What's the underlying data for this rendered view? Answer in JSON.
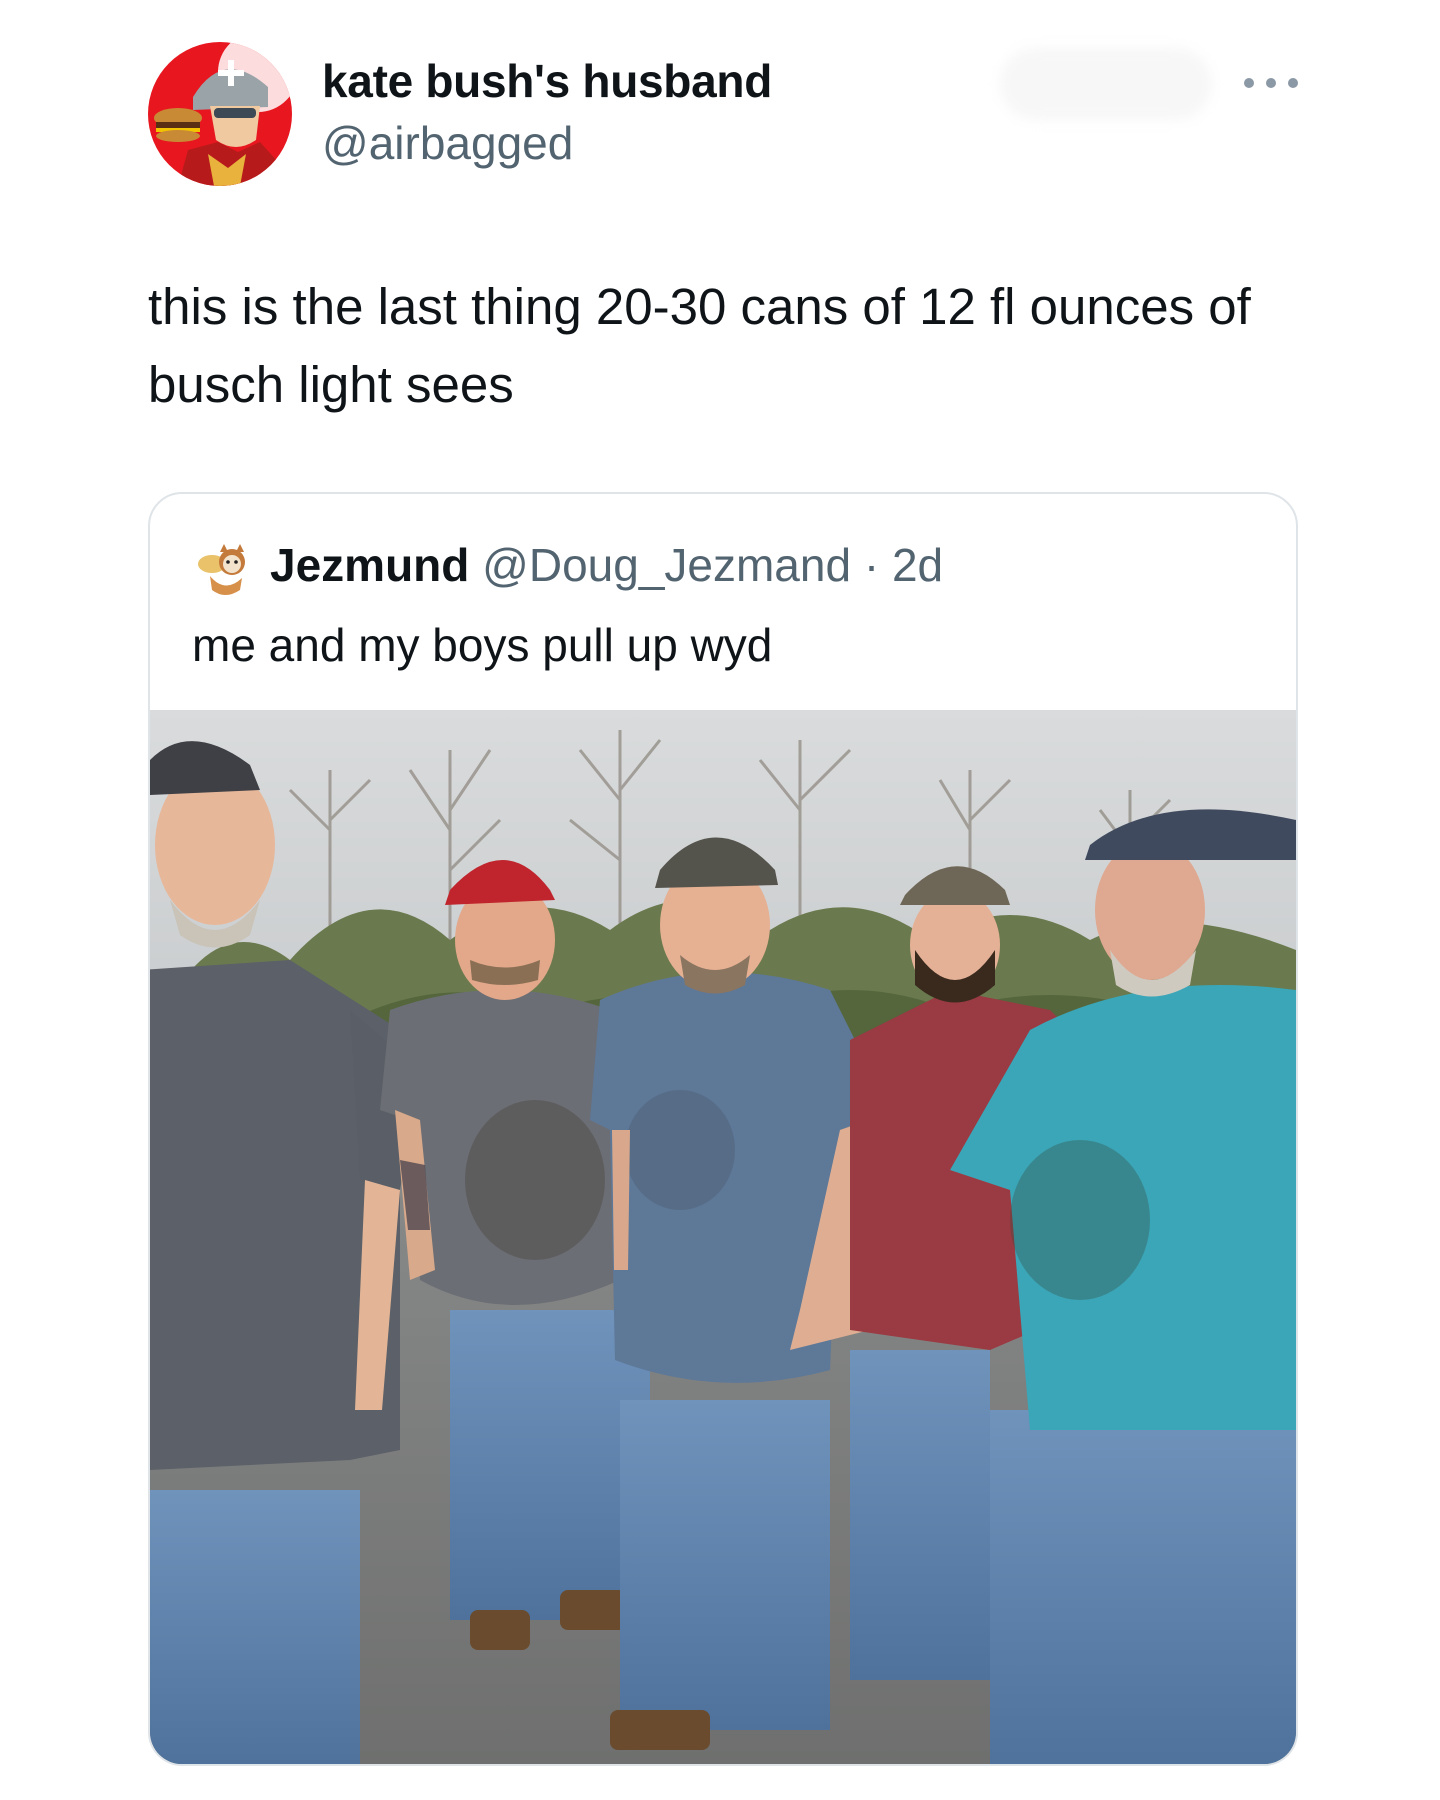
{
  "tweet": {
    "author": {
      "display_name": "kate bush's husband",
      "handle": "@airbagged",
      "avatar_icon": "profile-avatar-icon"
    },
    "more_icon": "more-options-icon",
    "text": "this is the last thing 20-30 cans of 12 fl ounces of busch light sees"
  },
  "quoted_tweet": {
    "author": {
      "display_name": "Jezmund",
      "handle": "@Doug_Jezmand",
      "avatar_icon": "quoted-avatar-icon"
    },
    "separator": "·",
    "time": "2d",
    "text": "me and my boys pull up wyd",
    "photo": {
      "subject": "five men standing in a parking lot",
      "shirt_colors": [
        "#5c6068",
        "#6b6e74",
        "#5e7898",
        "#9a3a42",
        "#3aa6b8"
      ],
      "cap_colors": [
        "#3e4046",
        "#c0242c",
        "#54534c",
        "#6e6656",
        "#404a5e"
      ]
    }
  },
  "colors": {
    "text_primary": "#0f1419",
    "text_secondary": "#536471",
    "card_border": "#dfe4e8",
    "background": "#ffffff"
  }
}
